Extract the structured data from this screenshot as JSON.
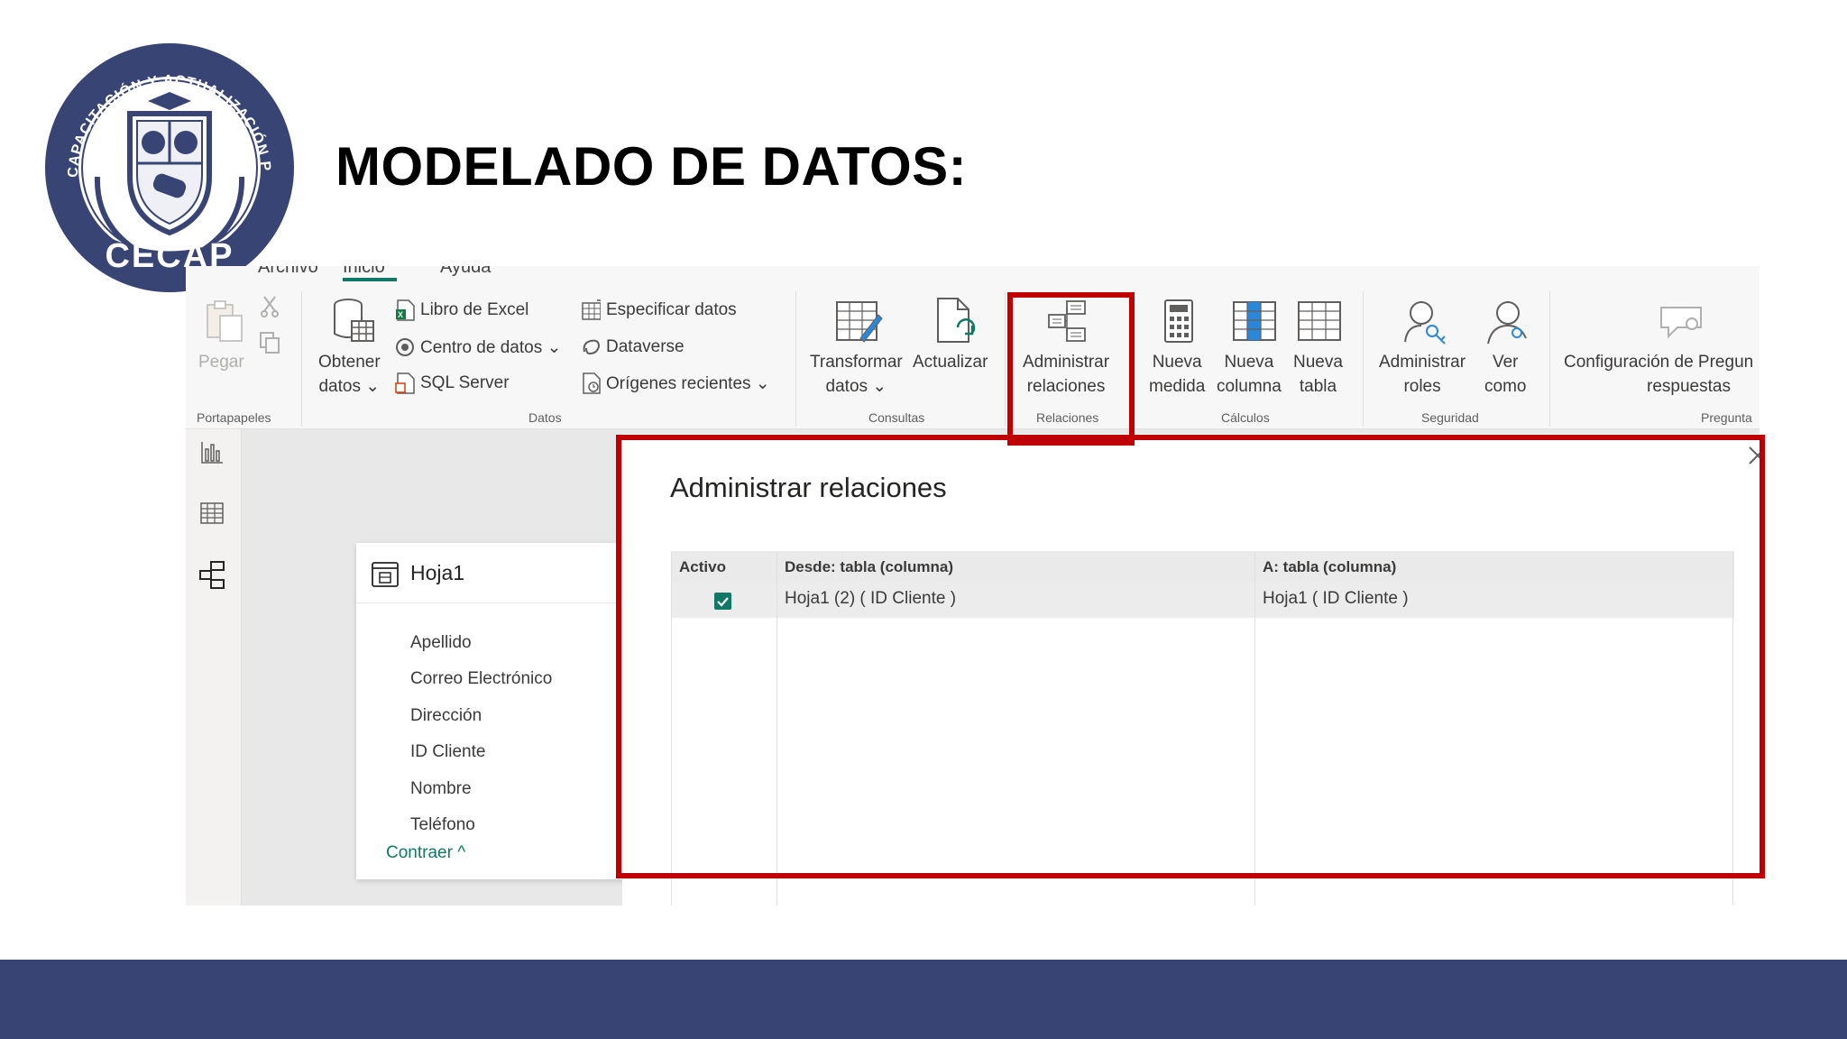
{
  "slide": {
    "title": "MODELADO DE DATOS:",
    "logo_text": [
      "CENTRO DE CAPACITACIÓN Y ACTUALIZACIÓN PROFESIONAL",
      "CECAP"
    ],
    "colors": {
      "footer": "#384473",
      "highlight": "#c00000",
      "accent": "#117865"
    }
  },
  "ribbon": {
    "tabs": [
      "Archivo",
      "Inicio",
      "Ayuda"
    ],
    "groups": {
      "portapapeles": {
        "label": "Portapapeles",
        "paste": "Pegar"
      },
      "datos": {
        "label": "Datos",
        "obtener_1": "Obtener",
        "obtener_2": "datos ⌄",
        "libro_excel": "Libro de Excel",
        "centro_datos": "Centro de datos ⌄",
        "sql_server": "SQL Server",
        "especificar": "Especificar datos",
        "dataverse": "Dataverse",
        "origenes": "Orígenes recientes ⌄"
      },
      "consultas": {
        "label": "Consultas",
        "transformar_1": "Transformar",
        "transformar_2": "datos ⌄",
        "actualizar": "Actualizar"
      },
      "relaciones": {
        "label": "Relaciones",
        "admin_1": "Administrar",
        "admin_2": "relaciones"
      },
      "calculos": {
        "label": "Cálculos",
        "nueva_medida_1": "Nueva",
        "nueva_medida_2": "medida",
        "nueva_columna_1": "Nueva",
        "nueva_columna_2": "columna",
        "nueva_tabla_1": "Nueva",
        "nueva_tabla_2": "tabla"
      },
      "seguridad": {
        "label": "Seguridad",
        "admin_roles_1": "Administrar",
        "admin_roles_2": "roles",
        "ver_como_1": "Ver",
        "ver_como_2": "como"
      },
      "preguntas": {
        "label": "Pregunta",
        "config_1": "Configuración de Pregun",
        "config_2": "respuestas"
      }
    }
  },
  "table_card": {
    "name": "Hoja1",
    "fields": [
      "Apellido",
      "Correo Electrónico",
      "Dirección",
      "ID Cliente",
      "Nombre",
      "Teléfono"
    ],
    "collapse": "Contraer ^"
  },
  "dialog": {
    "title": "Administrar relaciones",
    "columns": [
      "Activo",
      "Desde: tabla (columna)",
      "A: tabla (columna)"
    ],
    "rows": [
      {
        "activo": true,
        "desde": "Hoja1 (2) ( ID Cliente )",
        "a": "Hoja1 ( ID Cliente )"
      }
    ]
  }
}
